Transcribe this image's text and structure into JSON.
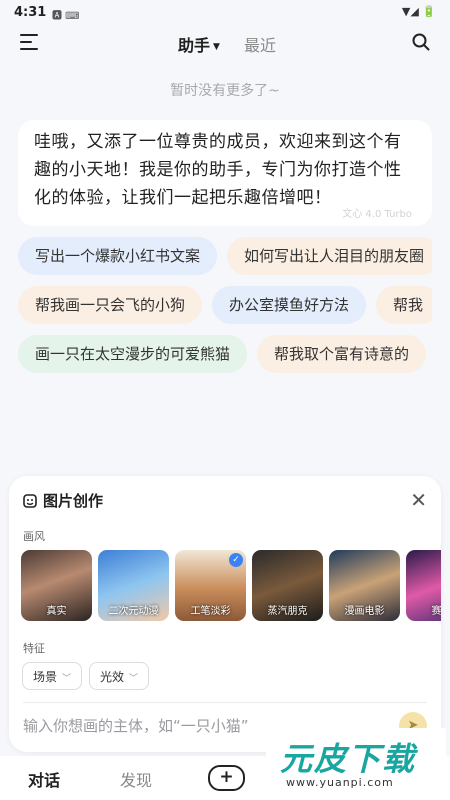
{
  "status_bar": {
    "time": "4:31",
    "left_icons": "🅰 ⌨",
    "right_icons": "▼◢ 🔋"
  },
  "header": {
    "tabs": [
      {
        "label": "助手",
        "active": true
      },
      {
        "label": "最近",
        "active": false
      }
    ]
  },
  "no_more_text": "暂时没有更多了~",
  "welcome_message": {
    "text": "哇哦，又添了一位尊贵的成员，欢迎来到这个有趣的小天地！我是你的助手，专门为你打造个性化的体验，让我们一起把乐趣倍增吧！",
    "model_watermark": "文心 4.0 Turbo"
  },
  "suggestions": [
    [
      "写出一个爆款小红书文案",
      "如何写出让人泪目的朋友圈"
    ],
    [
      "帮我画一只会飞的小狗",
      "办公室摸鱼好方法",
      "帮我"
    ],
    [
      "画一只在太空漫步的可爱熊猫",
      "帮我取个富有诗意的"
    ]
  ],
  "image_panel": {
    "title": "图片创作",
    "style_label": "画风",
    "styles": [
      {
        "label": "真实",
        "selected": false
      },
      {
        "label": "二次元动漫",
        "selected": false
      },
      {
        "label": "工笔淡彩",
        "selected": true
      },
      {
        "label": "蒸汽朋克",
        "selected": false
      },
      {
        "label": "漫画电影",
        "selected": false
      },
      {
        "label": "赛博",
        "selected": false
      }
    ],
    "feature_label": "特征",
    "features": [
      {
        "label": "场景"
      },
      {
        "label": "光效"
      }
    ],
    "input_placeholder": "输入你想画的主体，如“一只小猫”"
  },
  "bottom_nav": {
    "chat": "对话",
    "discover": "发现",
    "new": "+"
  },
  "watermark": {
    "brand": "元皮下载",
    "url": "www.yuanpi.com"
  },
  "colors": {
    "accent_blue": "#3b82f6",
    "chip_blue": "#e4edfb",
    "chip_peach": "#fbeee2",
    "chip_green": "#e4f4ea",
    "watermark_teal": "#1aa6a0"
  }
}
